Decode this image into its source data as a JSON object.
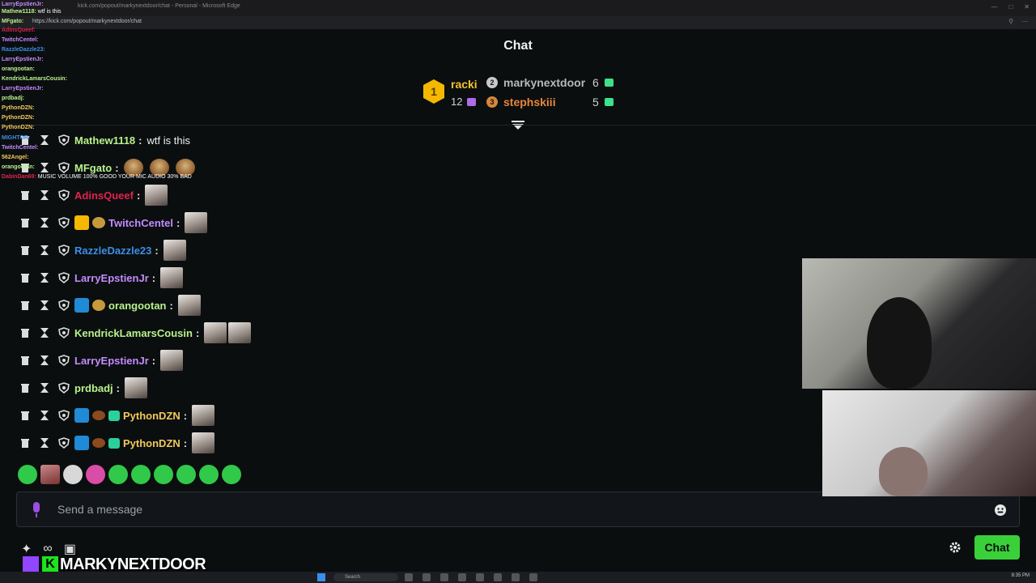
{
  "browser": {
    "title": "kick.com/popout/markynextdoor/chat - Personal - Microsoft Edge",
    "url": "https://kick.com/popout/markynextdoor/chat"
  },
  "chat": {
    "title": "Chat",
    "leaderboard": [
      {
        "rank": "1",
        "name": "racki",
        "count": "12"
      },
      {
        "rank": "2",
        "name": "markynextdoor",
        "count": "6"
      },
      {
        "rank": "3",
        "name": "stephskiii",
        "count": "5"
      }
    ],
    "messages": [
      {
        "user": "Mathew1118",
        "text": "wtf is this",
        "color": "#b8f28c"
      },
      {
        "user": "MFgato",
        "text": "",
        "color": "#b8f28c"
      },
      {
        "user": "AdinsQueef",
        "text": "",
        "color": "#e0234e"
      },
      {
        "user": "TwitchCentel",
        "text": "",
        "color": "#c38bff"
      },
      {
        "user": "RazzleDazzle23",
        "text": "",
        "color": "#3b8fe6"
      },
      {
        "user": "LarryEpstienJr",
        "text": "",
        "color": "#c38bff"
      },
      {
        "user": "orangootan",
        "text": "",
        "color": "#b8f28c"
      },
      {
        "user": "KendrickLamarsCousin",
        "text": "",
        "color": "#b8f28c"
      },
      {
        "user": "LarryEpstienJr",
        "text": "",
        "color": "#c38bff"
      },
      {
        "user": "prdbadj",
        "text": "",
        "color": "#b8f28c"
      },
      {
        "user": "PythonDZN",
        "text": "",
        "color": "#f2c95a"
      },
      {
        "user": "PythonDZN",
        "text": "",
        "color": "#f2c95a"
      }
    ],
    "input_placeholder": "Send a message",
    "send_label": "Chat",
    "accent": "#3ad03a"
  },
  "overlay": {
    "lines": [
      {
        "user": "LarryEpstienJr:",
        "text": "",
        "color": "#c38bff"
      },
      {
        "user": "Mathew1118:",
        "text": "wtf is this",
        "color": "#b8f28c"
      },
      {
        "user": "MFgato:",
        "text": "",
        "color": "#b8f28c"
      },
      {
        "user": "AdinsQueef:",
        "text": "",
        "color": "#e0234e"
      },
      {
        "user": "TwitchCentel:",
        "text": "",
        "color": "#c38bff"
      },
      {
        "user": "RazzleDazzle23:",
        "text": "",
        "color": "#3b8fe6"
      },
      {
        "user": "LarryEpstienJr:",
        "text": "",
        "color": "#c38bff"
      },
      {
        "user": "orangootan:",
        "text": "",
        "color": "#b8f28c"
      },
      {
        "user": "KendrickLamarsCousin:",
        "text": "",
        "color": "#b8f28c"
      },
      {
        "user": "LarryEpstienJr:",
        "text": "",
        "color": "#c38bff"
      },
      {
        "user": "prdbadj:",
        "text": "",
        "color": "#b8f28c"
      },
      {
        "user": "PythonDZN:",
        "text": "",
        "color": "#f2c95a"
      },
      {
        "user": "PythonDZN:",
        "text": "",
        "color": "#f2c95a"
      },
      {
        "user": "PythonDZN:",
        "text": "",
        "color": "#f2c95a"
      },
      {
        "user": "MIGHTOR:",
        "text": "",
        "color": "#3b8fe6"
      },
      {
        "user": "TwitchCentel:",
        "text": "",
        "color": "#c38bff"
      },
      {
        "user": "562Angel:",
        "text": "",
        "color": "#f2c95a"
      },
      {
        "user": "orangootan:",
        "text": "",
        "color": "#b8f28c"
      },
      {
        "user": "DabinDan69:",
        "text": "MUSIC VOLUME 100% GOOD YOUR MIC AUDIO 30% BAD",
        "color": "#e0234e"
      }
    ]
  },
  "stream": {
    "brand_text": "MARKYNEXTDOOR",
    "brand_letter": "K"
  },
  "taskbar": {
    "search": "Search",
    "time": "8:35 PM"
  }
}
